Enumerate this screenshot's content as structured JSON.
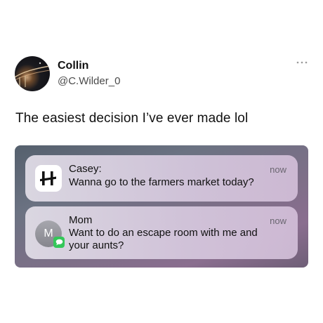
{
  "tweet": {
    "author_name": "Collin",
    "author_handle": "@C.Wilder_0",
    "text": "The easiest decision I’ve ever made lol",
    "more_icon": "more-horizontal-icon"
  },
  "screenshot": {
    "notifications": [
      {
        "app_icon": "hinge-app-icon",
        "title": "Casey:",
        "body": "Wanna go to the farmers market today?",
        "time": "now"
      },
      {
        "app_icon": "messages-app-icon",
        "avatar_initial": "M",
        "title": "Mom",
        "body": "Want to do an escape room with me and your aunts?",
        "time": "now"
      }
    ]
  },
  "colors": {
    "messages_badge": "#34c759",
    "text": "#111111",
    "handle": "#4a4a4a"
  }
}
